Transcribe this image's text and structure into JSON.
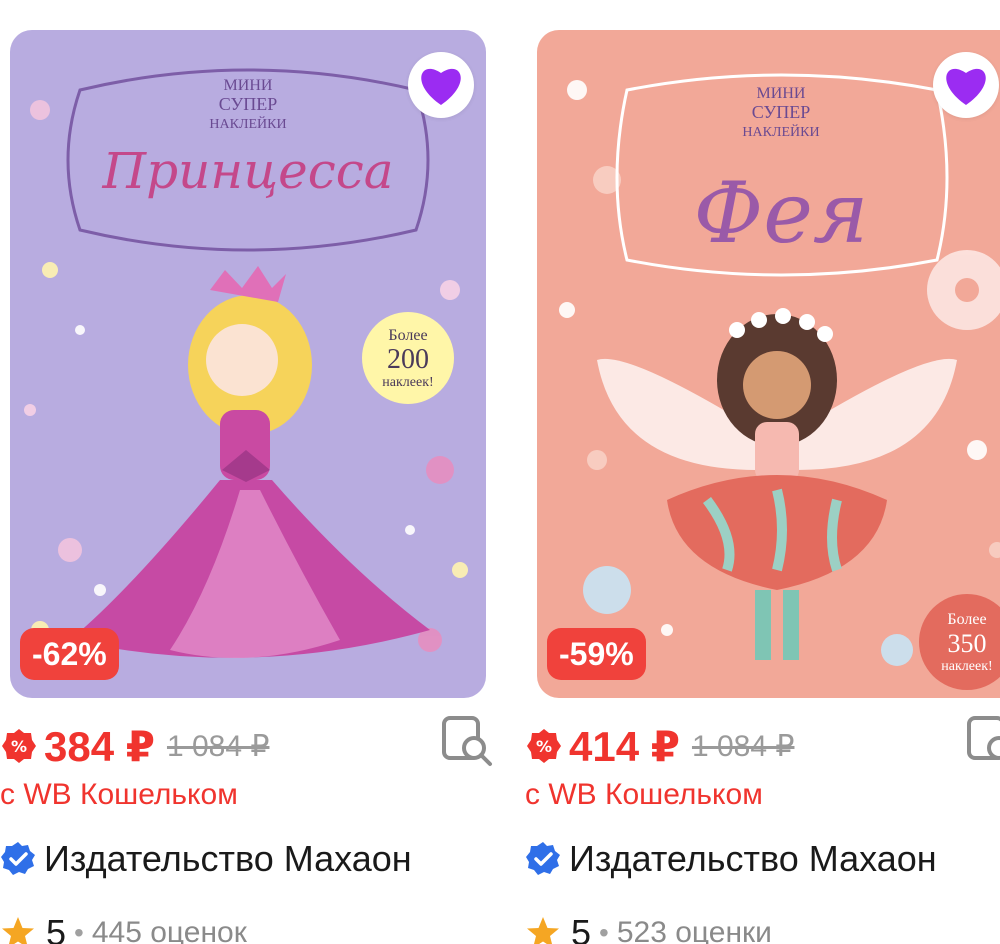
{
  "products": [
    {
      "cover_series": "МИНИ СУПЕР НАКЛЕЙКИ",
      "cover_series_lines": [
        "МИНИ",
        "СУПЕР",
        "НАКЛЕЙКИ"
      ],
      "cover_title": "Принцесса",
      "cover_badge_lines": [
        "Более",
        "200",
        "наклеек!"
      ],
      "discount": "-62%",
      "price": "384 ₽",
      "old_price": "1 084 ₽",
      "wallet_label": "с WB Кошельком",
      "brand": "Издательство Махаон",
      "rating": "5",
      "reviews": "445 оценок",
      "colors": {
        "cover_bg": "#b8ace0",
        "title": "#c4488a"
      }
    },
    {
      "cover_series": "МИНИ СУПЕР НАКЛЕЙКИ",
      "cover_series_lines": [
        "МИНИ",
        "СУПЕР",
        "НАКЛЕЙКИ"
      ],
      "cover_title": "Фея",
      "cover_badge_lines": [
        "Более",
        "350",
        "наклеек!"
      ],
      "discount": "-59%",
      "price": "414 ₽",
      "old_price": "1 084 ₽",
      "wallet_label": "с WB Кошельком",
      "brand": "Издательство Махаон",
      "rating": "5",
      "reviews": "523 оценки",
      "colors": {
        "cover_bg": "#f2a898",
        "title": "#9a5aa8"
      }
    }
  ],
  "icons": {
    "favorite": "heart-icon",
    "sale": "sale-badge-icon",
    "similar": "search-similar-icon",
    "verified": "verified-check-icon",
    "rating": "star-icon"
  },
  "theme": {
    "accent_red": "#f0342e",
    "discount_bg": "#f0423c",
    "heart": "#9b2cf2",
    "verified": "#2f6fe8",
    "star": "#f5a623"
  }
}
